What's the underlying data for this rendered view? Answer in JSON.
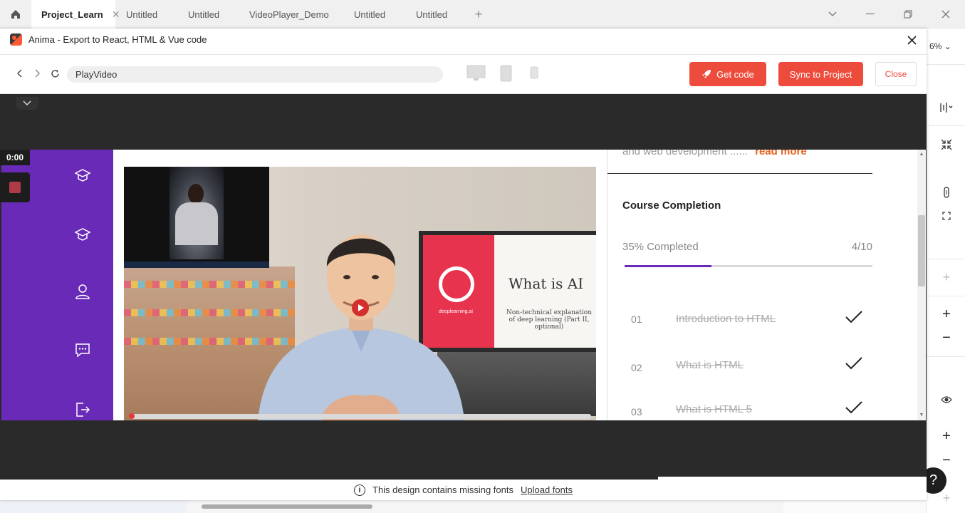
{
  "tabs": [
    {
      "label": "Project_Learn",
      "active": true,
      "closable": true
    },
    {
      "label": "Untitled"
    },
    {
      "label": "Untitled"
    },
    {
      "label": "VideoPlayer_Demo"
    },
    {
      "label": "Untitled"
    },
    {
      "label": "Untitled"
    }
  ],
  "editor": {
    "zoom": "6%"
  },
  "modal": {
    "title": "Anima - Export to React, HTML & Vue code",
    "url": "PlayVideo",
    "get_code": "Get code",
    "sync": "Sync to Project",
    "close": "Close"
  },
  "recorder": {
    "time": "0:00"
  },
  "course": {
    "description": "and web development ......",
    "read_more": "read more",
    "title": "Course Completion",
    "percent_label": "35% Completed",
    "count": "4/10",
    "progress": 0.35,
    "lessons": [
      {
        "num": "01",
        "name": "Introduction to HTML",
        "done": true
      },
      {
        "num": "02",
        "name": "What is HTML",
        "done": true
      },
      {
        "num": "03",
        "name": "What is HTML 5",
        "done": true
      }
    ]
  },
  "video": {
    "slide_title": "What is AI",
    "slide_subtitle": "Non-technical explanation of deep learning (Part II, optional)",
    "slide_brand": "deeplearning.ai"
  },
  "footer": {
    "message": "This design contains missing fonts",
    "upload": "Upload fonts"
  },
  "colors": {
    "accent": "#ed4c3c",
    "sidebar": "#6a2ab8",
    "read_more": "#e8621e"
  }
}
